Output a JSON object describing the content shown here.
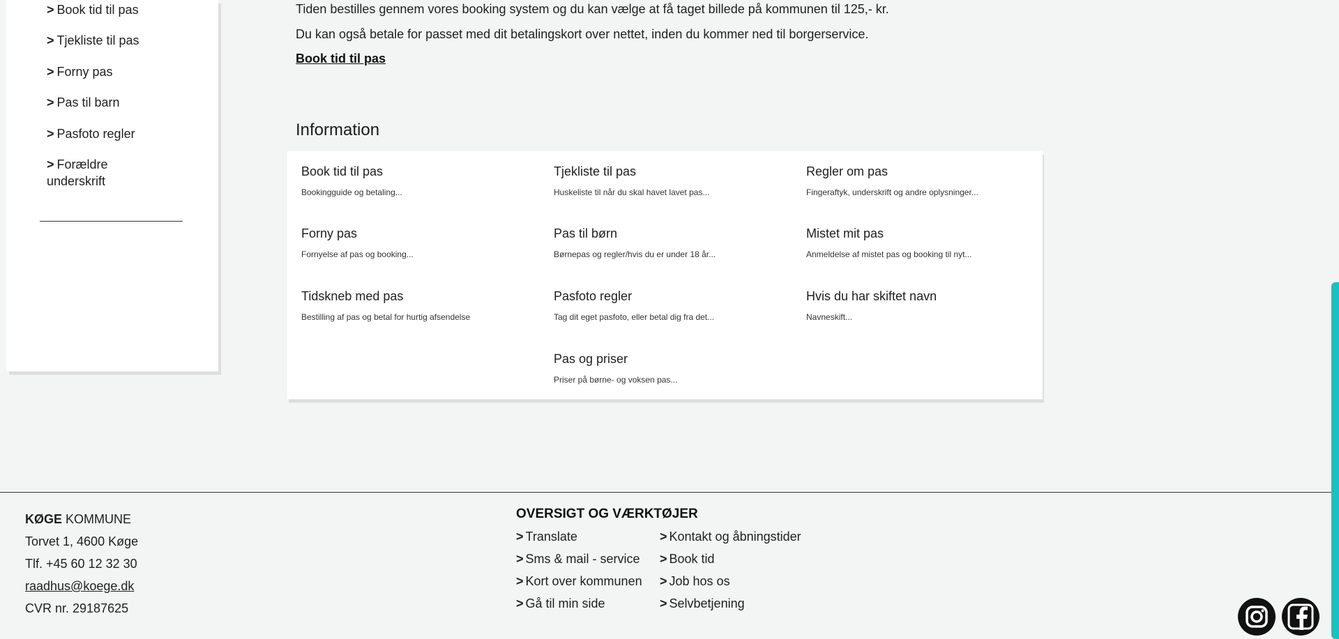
{
  "sidebar": {
    "items": [
      {
        "arrow": ">",
        "label": "Book tid til pas"
      },
      {
        "arrow": ">",
        "label": "Tjekliste til pas"
      },
      {
        "arrow": ">",
        "label": "Forny pas"
      },
      {
        "arrow": ">",
        "label": "Pas til barn"
      },
      {
        "arrow": ">",
        "label": "Pasfoto regler"
      },
      {
        "arrow": ">",
        "label": "Forældre underskrift"
      }
    ]
  },
  "main": {
    "intro_line_1": "Tiden bestilles gennem vores booking system og du kan vælge at få taget billede på kommunen til 125,- kr.",
    "intro_line_2": "Du kan også betale for passet med dit betalingskort over nettet, inden du kommer ned til borgerservice.",
    "book_link": "Book tid til pas",
    "section_title": "Information",
    "info_items": [
      {
        "title": "Book tid til pas",
        "desc": "Bookingguide og betaling..."
      },
      {
        "title": "Tjekliste til pas",
        "desc": "Huskeliste til når du skal havet lavet pas..."
      },
      {
        "title": "Regler om pas",
        "desc": "Fingeraftyk, underskrift og andre oplysninger..."
      },
      {
        "title": "Forny pas",
        "desc": "Fornyelse af pas og booking..."
      },
      {
        "title": "Pas til børn",
        "desc": "Børnepas og regler/hvis du er under 18 år..."
      },
      {
        "title": "Mistet mit pas",
        "desc": "Anmeldelse af mistet pas og booking til nyt..."
      },
      {
        "title": "Tidskneb med pas",
        "desc": "Bestilling af pas og betal for hurtig afsendelse"
      },
      {
        "title": "Pasfoto regler",
        "desc": "Tag dit eget pasfoto, eller betal dig fra det..."
      },
      {
        "title": "Hvis du har skiftet navn",
        "desc": "Navneskift..."
      },
      {
        "title": "Pas og priser",
        "desc": "Priser på børne- og voksen pas..."
      }
    ]
  },
  "footer": {
    "org_bold": "KØGE",
    "org_rest": "KOMMUNE",
    "address": "Torvet 1, 4600 Køge",
    "phone": "Tlf. +45 60 12 32 30",
    "email": "raadhus@koege.dk",
    "cvr": "CVR nr. 29187625",
    "tools_heading": "OVERSIGT OG VÆRKTØJER",
    "links_col1": [
      {
        "arrow": ">",
        "label": "Translate"
      },
      {
        "arrow": ">",
        "label": "Sms & mail - service"
      },
      {
        "arrow": ">",
        "label": "Kort over kommunen"
      },
      {
        "arrow": ">",
        "label": "Gå til min side"
      }
    ],
    "links_col2": [
      {
        "arrow": ">",
        "label": "Kontakt og åbningstider"
      },
      {
        "arrow": ">",
        "label": "Book tid"
      },
      {
        "arrow": ">",
        "label": "Job hos os"
      },
      {
        "arrow": ">",
        "label": "Selvbetjening"
      }
    ]
  },
  "social": {
    "icons": [
      "instagram-icon",
      "facebook-icon"
    ]
  },
  "colors": {
    "background": "#f2f5f4",
    "scrollbar_thumb": "#16c2c2"
  }
}
